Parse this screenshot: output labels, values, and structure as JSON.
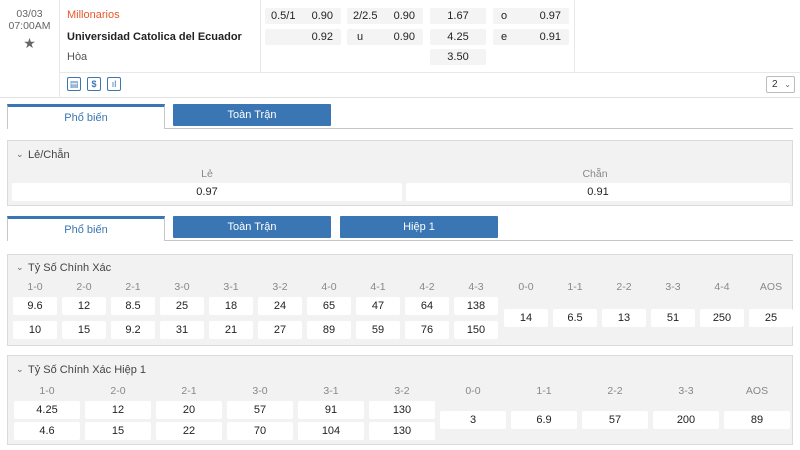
{
  "match": {
    "date": "03/03",
    "time": "07:00AM",
    "home": "Millonarios",
    "away": "Universidad Catolica del Ecuador",
    "draw": "Hòa",
    "handicap": {
      "line": "0.5/1",
      "home_odds": "0.90",
      "away_odds": "0.92"
    },
    "overunder": {
      "line": "2/2.5",
      "over_label": "u",
      "over_odds": "0.90",
      "under_odds": "0.90"
    },
    "x12": {
      "home": "1.67",
      "away": "4.25",
      "draw": "3.50"
    },
    "oddeven": {
      "odd_label": "o",
      "odd": "0.97",
      "even_label": "e",
      "even": "0.91"
    },
    "icons": [
      "list-icon",
      "dollar-icon",
      "bar-chart-icon"
    ],
    "pager": "2"
  },
  "colors": {
    "accent": "#3a76b4",
    "home_team": "#e8572a",
    "panel_bg": "#f2f2f2"
  },
  "tabs1": {
    "active": "Phổ biến",
    "full": "Toàn Trận"
  },
  "oddeven_panel": {
    "title": "Lẻ/Chẵn",
    "odd_label": "Lẻ",
    "odd": "0.97",
    "even_label": "Chẵn",
    "even": "0.91"
  },
  "tabs2": {
    "active": "Phổ biến",
    "full": "Toàn Trận",
    "half": "Hiệp 1"
  },
  "correct_score": {
    "title": "Tỷ Số Chính Xác",
    "home_labels": [
      "1-0",
      "2-0",
      "2-1",
      "3-0",
      "3-1",
      "3-2",
      "4-0",
      "4-1",
      "4-2",
      "4-3"
    ],
    "home_row": [
      "9.6",
      "12",
      "8.5",
      "25",
      "18",
      "24",
      "65",
      "47",
      "64",
      "138"
    ],
    "away_row": [
      "10",
      "15",
      "9.2",
      "31",
      "21",
      "27",
      "89",
      "59",
      "76",
      "150"
    ],
    "draw_labels": [
      "0-0",
      "1-1",
      "2-2",
      "3-3",
      "4-4",
      "AOS"
    ],
    "draw_row": [
      "14",
      "6.5",
      "13",
      "51",
      "250",
      "25"
    ]
  },
  "correct_score_half": {
    "title": "Tỷ Số Chính Xác Hiệp 1",
    "home_labels": [
      "1-0",
      "2-0",
      "2-1",
      "3-0",
      "3-1",
      "3-2"
    ],
    "home_row": [
      "4.25",
      "12",
      "20",
      "57",
      "91",
      "130"
    ],
    "away_row": [
      "4.6",
      "15",
      "22",
      "70",
      "104",
      "130"
    ],
    "draw_labels": [
      "0-0",
      "1-1",
      "2-2",
      "3-3",
      "AOS"
    ],
    "draw_row": [
      "3",
      "6.9",
      "57",
      "200",
      "89"
    ]
  }
}
